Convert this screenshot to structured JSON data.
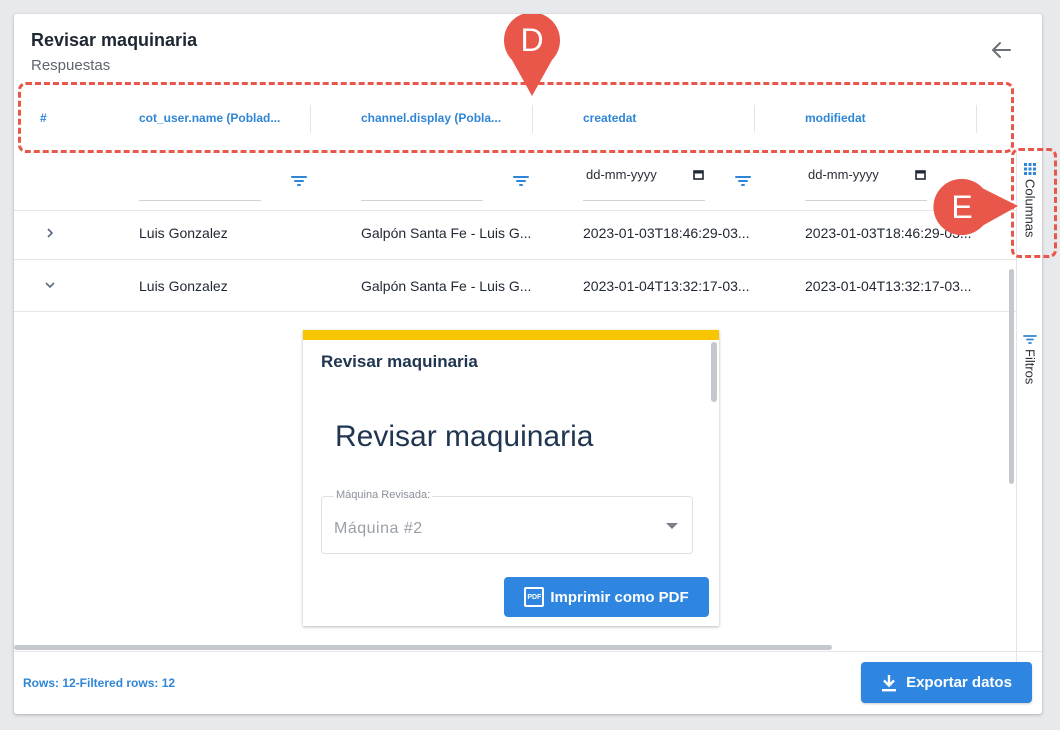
{
  "header": {
    "title": "Revisar maquinaria",
    "subtitle": "Respuestas"
  },
  "table": {
    "columns": [
      "#",
      "cot_user.name (Poblad...",
      "channel.display (Pobla...",
      "createdat",
      "modifiedat"
    ],
    "date_placeholder": "dd-mm-yyyy",
    "rows": [
      {
        "expander": "collapsed",
        "user": "Luis Gonzalez",
        "channel": "Galpón Santa Fe - Luis G...",
        "created": "2023-01-03T18:46:29-03...",
        "modified": "2023-01-03T18:46:29-03..."
      },
      {
        "expander": "expanded",
        "user": "Luis Gonzalez",
        "channel": "Galpón Santa Fe - Luis G...",
        "created": "2023-01-04T13:32:17-03...",
        "modified": "2023-01-04T13:32:17-03..."
      }
    ]
  },
  "side_panel": {
    "columns_label": "Columnas",
    "filters_label": "Filtros"
  },
  "form": {
    "header_title": "Revisar maquinaria",
    "big_title": "Revisar maquinaria",
    "select_label": "Máquina Revisada:",
    "select_value": "Máquina #2",
    "pdf_button": "Imprimir como PDF",
    "accent_color": "#f7c600"
  },
  "footer": {
    "rows_text": "Rows: 12-Filtered rows: 12",
    "export_button": "Exportar datos"
  },
  "annotations": {
    "marker_d": "D",
    "marker_e": "E",
    "color": "#e8574a"
  },
  "colors": {
    "accent": "#2f86e0",
    "header_text": "#2f86d6"
  }
}
